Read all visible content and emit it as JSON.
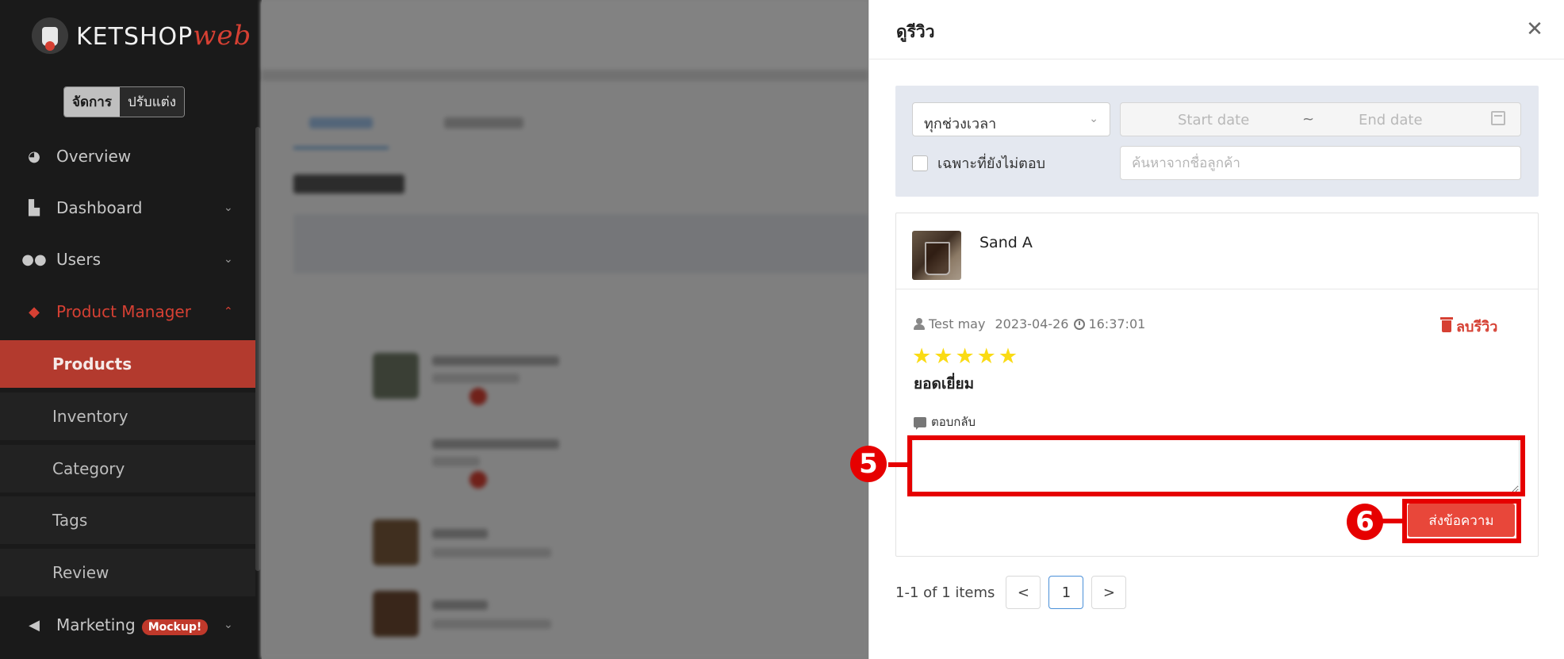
{
  "sidebar": {
    "logo": {
      "text": "KETSHOP",
      "accent": "web"
    },
    "mode_switch": {
      "active": "จัดการ",
      "inactive": "ปรับแต่ง"
    },
    "nav": [
      {
        "label": "Overview",
        "icon": "pie-chart-icon"
      },
      {
        "label": "Dashboard",
        "icon": "bar-chart-icon"
      },
      {
        "label": "Users",
        "icon": "users-icon"
      },
      {
        "label": "Product Manager",
        "icon": "tags-icon"
      },
      {
        "label": "Marketing",
        "icon": "megaphone-icon",
        "badge": "Mockup!"
      }
    ],
    "product_submenu": [
      "Products",
      "Inventory",
      "Category",
      "Tags",
      "Review"
    ],
    "selected": "Products"
  },
  "drawer": {
    "title": "ดูรีวิว",
    "filters": {
      "period_select": "ทุกช่วงเวลา",
      "start_placeholder": "Start date",
      "range_separator": "~",
      "end_placeholder": "End date",
      "unanswered_only_label": "เฉพาะที่ยังไม่ตอบ",
      "search_placeholder": "ค้นหาจากชื่อลูกค้า"
    },
    "review": {
      "product_name": "Sand A",
      "reviewer": "Test may",
      "date": "2023-04-26",
      "time": "16:37:01",
      "delete_label": "ลบรีวิว",
      "rating": 5,
      "text": "ยอดเยี่ยม",
      "reply_label": "ตอบกลับ",
      "reply_value": "",
      "send_label": "ส่งข้อความ"
    },
    "callouts": {
      "step5": "5",
      "step6": "6"
    },
    "pagination": {
      "info": "1-1 of 1 items",
      "prev": "<",
      "current_page": "1",
      "next": ">"
    }
  },
  "colors": {
    "accent": "#d64033",
    "highlight": "#e60000",
    "star": "#fadb14",
    "link": "#4a90d9"
  }
}
